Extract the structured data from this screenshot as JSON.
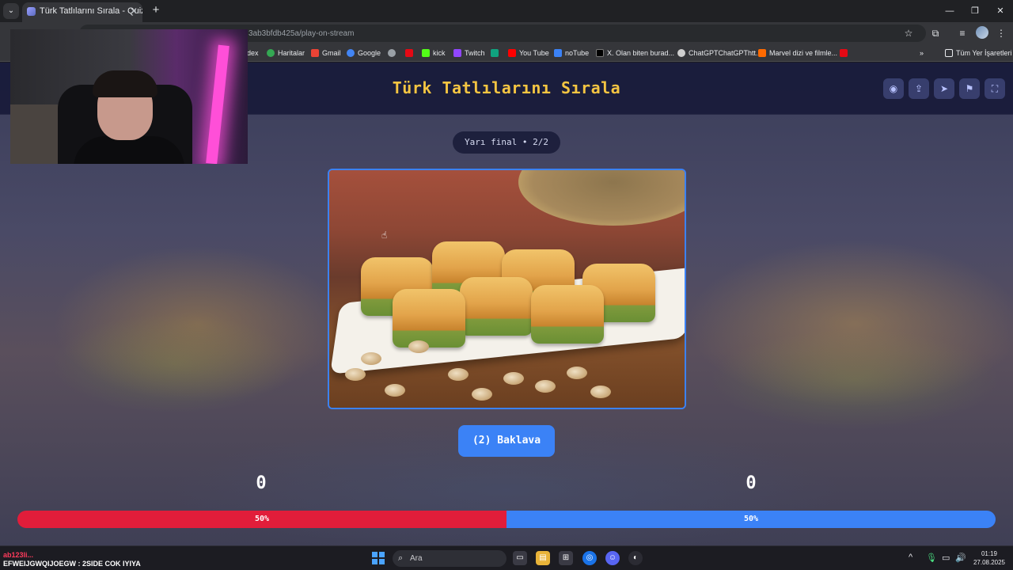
{
  "browser": {
    "tab_title": "Türk Tatlılarını Sırala - Quizei",
    "url_visible": "3ab3bfdb425a/play-on-stream",
    "new_tab": "+",
    "tab_list": "⌄",
    "tab_close": "✕",
    "window": {
      "minimize": "—",
      "restore": "❐",
      "close": "✕"
    },
    "bookmarks": [
      {
        "label": "dex",
        "color": "#5f6368"
      },
      {
        "label": "Haritalar",
        "color": "#34a853"
      },
      {
        "label": "Gmail",
        "color": "#ea4335"
      },
      {
        "label": "Google",
        "color": "#4285f4"
      },
      {
        "label": "",
        "color": "#9aa0a6"
      },
      {
        "label": "",
        "color": "#e50914"
      },
      {
        "label": "kick",
        "color": "#53fc18"
      },
      {
        "label": "Twitch",
        "color": "#9146ff"
      },
      {
        "label": "",
        "color": "#10a37f"
      },
      {
        "label": "You Tube",
        "color": "#ff0000"
      },
      {
        "label": "noTube",
        "color": "#3b82f6"
      },
      {
        "label": "X. Olan biten burad...",
        "color": "#000000"
      },
      {
        "label": "ChatGPTChatGPThtt...",
        "color": "#cfcfcf"
      },
      {
        "label": "Marvel dizi ve filmle...",
        "color": "#ff6a00"
      },
      {
        "label": "",
        "color": "#e50914"
      }
    ],
    "more_bookmarks": "»",
    "all_bookmarks": "Tüm Yer İşaretleri"
  },
  "quiz": {
    "title": "Türk Tatlılarını Sırala",
    "round_label": "Yarı final • 2/2",
    "current_item": "(2) Baklava",
    "score_left": "0",
    "score_right": "0",
    "vote_left_percent": "50%",
    "vote_right_percent": "50%",
    "vote_left_fraction": 0.5,
    "header_buttons": [
      "eye-icon",
      "share-icon",
      "send-icon",
      "flag-icon",
      "fullscreen-icon"
    ],
    "accent_yellow": "#f5c542",
    "accent_blue": "#3b82f6",
    "accent_red": "#e11d3a"
  },
  "stream": {
    "chat_user": "ab123li...",
    "chat_message": "EFWEIJGWQIJOEGW : 2SIDE COK IYIYA"
  },
  "taskbar": {
    "search_placeholder": "Ara",
    "time": "01:19",
    "date": "27.08.2025"
  }
}
